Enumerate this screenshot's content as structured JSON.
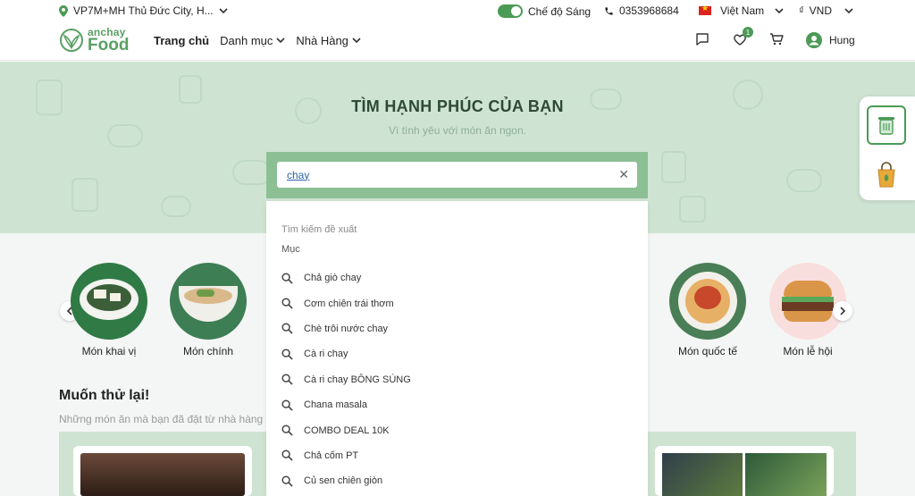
{
  "topbar": {
    "location": "VP7M+MH Thủ Đức City, H...",
    "theme_label": "Chế độ Sáng",
    "phone": "0353968684",
    "language": "Việt Nam",
    "currency_symbol": "₫",
    "currency": "VND"
  },
  "header": {
    "logo_small": "anchay",
    "logo_big": "Food",
    "nav": [
      {
        "label": "Trang chủ"
      },
      {
        "label": "Danh mục"
      },
      {
        "label": "Nhà Hàng"
      }
    ],
    "wishlist_count": "1",
    "user_name": "Hung"
  },
  "hero": {
    "title": "TÌM HẠNH PHÚC CỦA BẠN",
    "subtitle": "Vì tình yêu với món ăn ngon."
  },
  "search": {
    "value": "chay"
  },
  "dropdown": {
    "header": "Tìm kiếm đề xuất",
    "section": "Mục",
    "items": [
      "Chả giò chay",
      "Cơm chiên trái thơm",
      "Chè trôi nước chay",
      "Cà ri chay",
      "Cà ri chay BÔNG SÚNG",
      "Chana masala",
      "COMBO DEAL 10K",
      "Chả cốm PT",
      "Củ sen chiên giòn"
    ]
  },
  "categories": [
    {
      "label": "Món khai vị"
    },
    {
      "label": "Món chính"
    },
    {
      "label": "Món quốc tế"
    },
    {
      "label": "Món lễ hội"
    }
  ],
  "recent": {
    "title": "Muốn thử lại!",
    "subtitle": "Những món ăn mà bạn đã đặt từ nhà hàng g"
  },
  "colors": {
    "brand": "#4b9a55",
    "hero_bg": "#cfe3d3"
  }
}
